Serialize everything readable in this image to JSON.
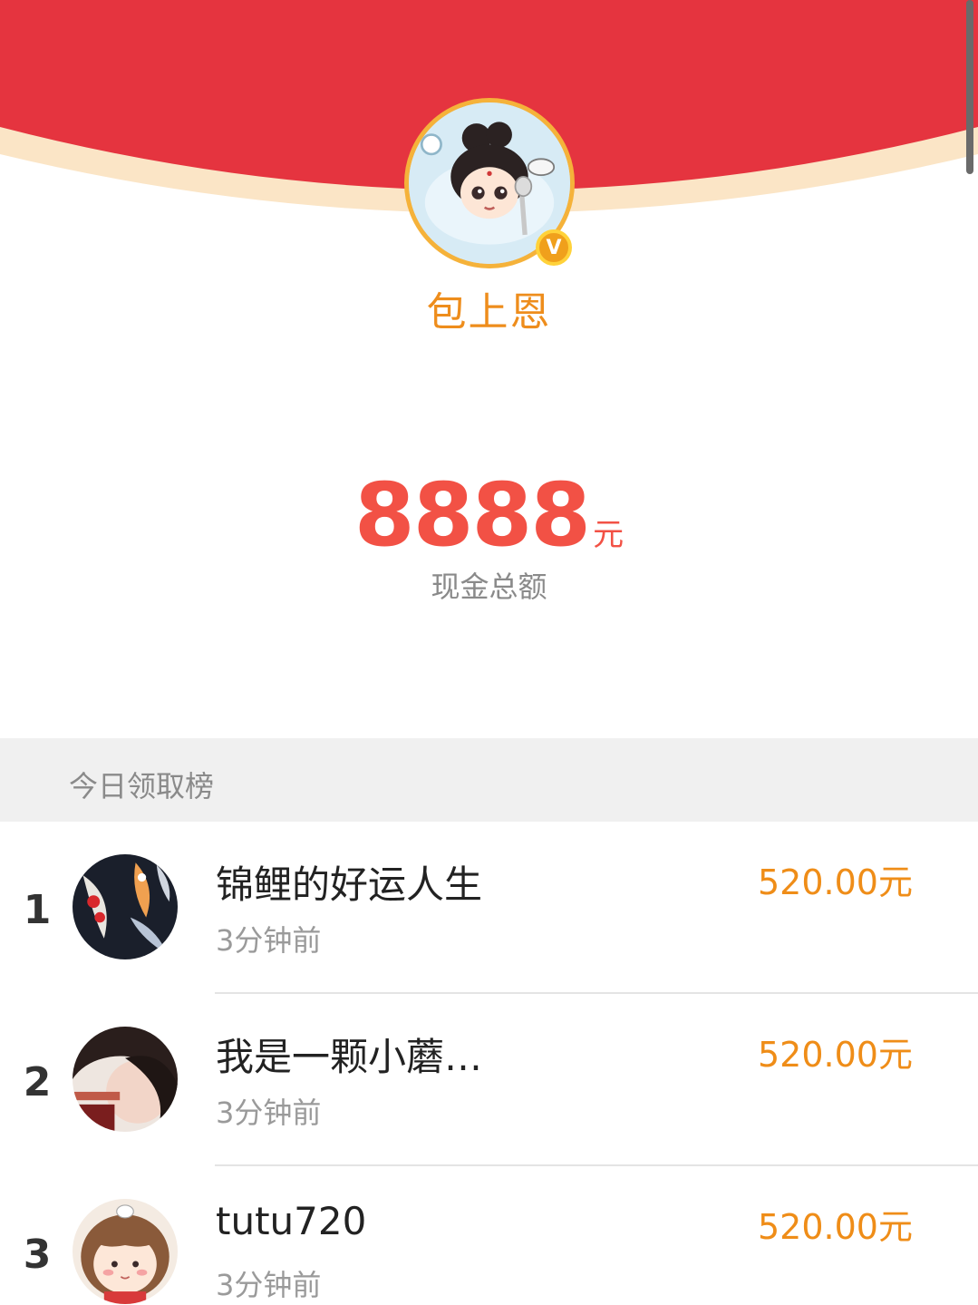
{
  "header": {
    "color": "#e5343f",
    "cream": "#fbe5c6"
  },
  "profile": {
    "name": "包上恩",
    "avatar_icon": "avatar-chibi-girl-icon",
    "verified_mark": "V"
  },
  "summary": {
    "amount": "8888",
    "unit": "元",
    "label": "现金总额"
  },
  "leaderboard": {
    "title": "今日领取榜",
    "rows": [
      {
        "rank": "1",
        "name": "锦鲤的好运人生",
        "time": "3分钟前",
        "amount": "520.00元",
        "avatar_icon": "koi-fish-avatar-icon"
      },
      {
        "rank": "2",
        "name": "我是一颗小蘑…",
        "time": "3分钟前",
        "amount": "520.00元",
        "avatar_icon": "portrait-avatar-icon"
      },
      {
        "rank": "3",
        "name": "tutu720",
        "time": "3分钟前",
        "amount": "520.00元",
        "avatar_icon": "cartoon-girl-avatar-icon"
      }
    ]
  }
}
